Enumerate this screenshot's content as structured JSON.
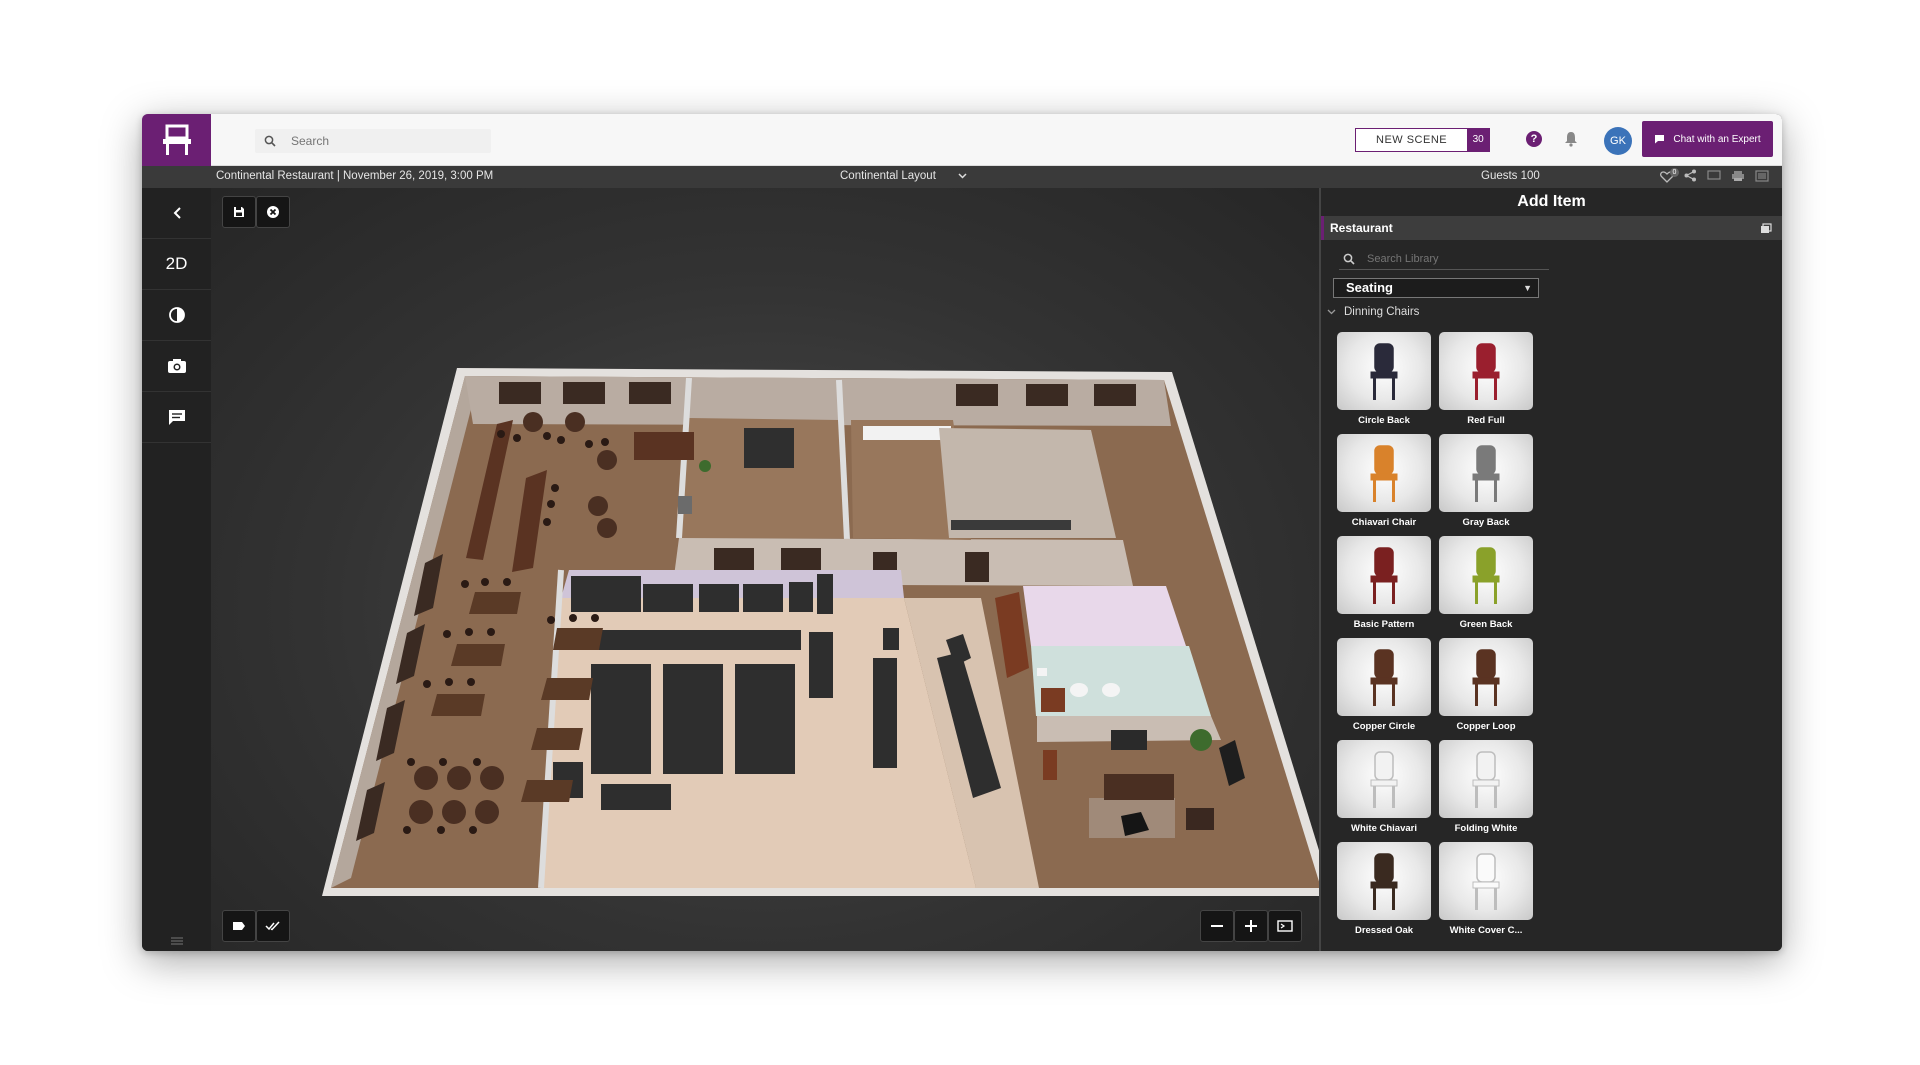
{
  "header": {
    "search_placeholder": "Search",
    "new_scene_label": "NEW SCENE",
    "new_scene_count": "30",
    "help_label": "?",
    "avatar_initials": "GK",
    "chat_label": "Chat with an Expert"
  },
  "infobar": {
    "scene_title": "Continental Restaurant | November 26, 2019, 3:00 PM",
    "layout_name": "Continental Layout",
    "guests": "Guests 100",
    "favorites_count": "0"
  },
  "sidebar": {
    "view_mode": "2D"
  },
  "panel": {
    "title": "Add Item",
    "category": "Restaurant",
    "search_placeholder": "Search Library",
    "filter_selected": "Seating",
    "subcategory": "Dinning Chairs",
    "items": [
      {
        "label": "Circle Back",
        "color": "#2a2a3a"
      },
      {
        "label": "Red Full",
        "color": "#9a1f2e"
      },
      {
        "label": "Chiavari Chair",
        "color": "#d9822b"
      },
      {
        "label": "Gray Back",
        "color": "#7a7a7a"
      },
      {
        "label": "Basic Pattern",
        "color": "#7a2020"
      },
      {
        "label": "Green Back",
        "color": "#8aa12a"
      },
      {
        "label": "Copper Circle",
        "color": "#5a3322"
      },
      {
        "label": "Copper Loop",
        "color": "#5a3322"
      },
      {
        "label": "White Chiavari",
        "color": "#f2f2f2"
      },
      {
        "label": "Folding White",
        "color": "#f2f2f2"
      },
      {
        "label": "Dressed Oak",
        "color": "#3a2a20"
      },
      {
        "label": "White Cover C...",
        "color": "#fafafa"
      }
    ]
  },
  "colors": {
    "brand": "#6b1f73",
    "floor_wood": "#8b6a50",
    "wall": "#b9aca2",
    "furniture_dark": "#3a3a3a"
  }
}
